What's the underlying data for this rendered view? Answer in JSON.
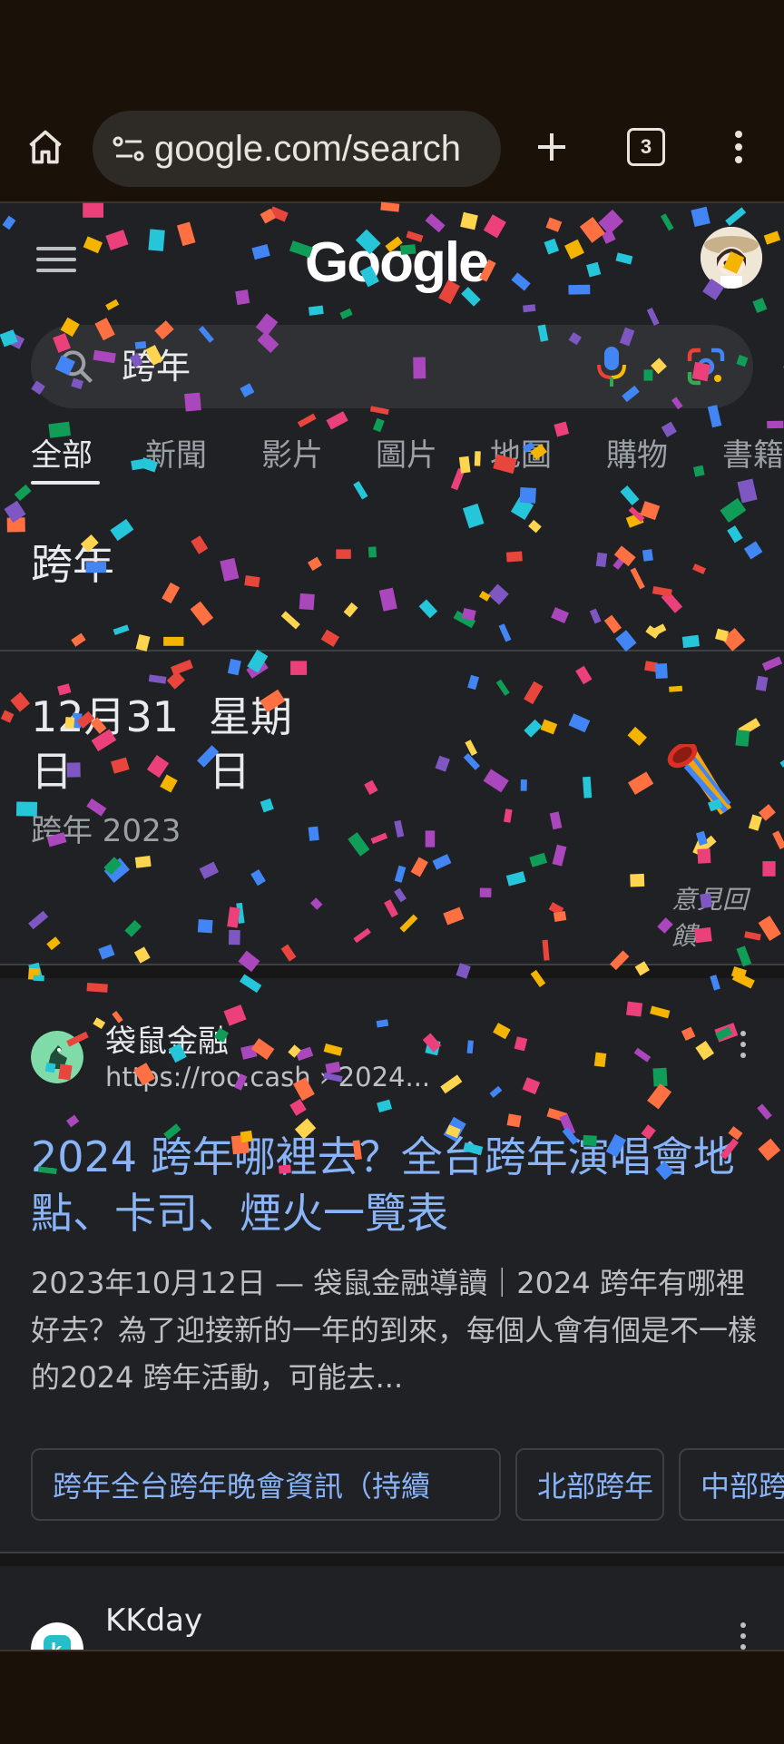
{
  "browser": {
    "url": "google.com/search",
    "tab_count": "3"
  },
  "google": {
    "logo": "Google",
    "query": "跨年",
    "tabs": [
      "全部",
      "新聞",
      "影片",
      "圖片",
      "地圖",
      "購物",
      "書籍"
    ]
  },
  "answer_card": {
    "heading": "跨年",
    "date_line1": "12月31",
    "date_line2": "日",
    "weekday_line1": "星期",
    "weekday_line2": "日",
    "subtitle": "跨年 2023",
    "feedback": "意見回饋"
  },
  "result1": {
    "site_name": "袋鼠金融",
    "site_url": "https://roo.cash › 2024...",
    "title": "2024 跨年哪裡去？全台跨年演唱會地點、卡司、煙火一覽表",
    "snippet": "2023年10月12日 — 袋鼠金融導讀｜2024 跨年有哪裡好去？為了迎接新的一年的到來，每個人會有個是不一樣的2024 跨年活動，可能去...",
    "chips": [
      "跨年全台跨年晚會資訊（持續",
      "北部跨年",
      "中部跨"
    ]
  },
  "result2": {
    "site_name": "KKday"
  },
  "colors": {
    "page_bg": "#202124",
    "chrome_bg": "#1a1209",
    "link": "#8ab4f8",
    "text": "#e8eaed",
    "muted": "#9aa0a6"
  },
  "icons": [
    "home-icon",
    "site-settings-icon",
    "new-tab-icon",
    "tab-switcher-icon",
    "more-menu-icon",
    "hamburger-menu-icon",
    "search-icon",
    "microphone-icon",
    "google-lens-icon",
    "party-popper-icon",
    "kebab-menu-icon"
  ]
}
